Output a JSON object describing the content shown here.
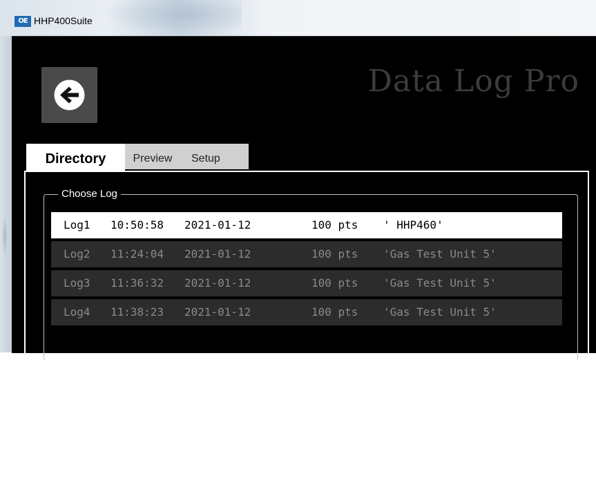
{
  "window": {
    "title": "HHP400Suite",
    "icon_text": "OE"
  },
  "header": {
    "brand_title": "Data Log Pro",
    "back_icon": "arrow-left-icon"
  },
  "tabs": [
    {
      "label": "Directory",
      "active": true
    },
    {
      "label": "Preview",
      "active": false
    },
    {
      "label": "Setup",
      "active": false
    }
  ],
  "directory": {
    "group_title": "Choose Log",
    "logs": [
      {
        "name": "Log1",
        "time": "10:50:58",
        "date": "2021-01-12",
        "points": "100 pts",
        "label": "' HHP460'",
        "selected": true
      },
      {
        "name": "Log2",
        "time": "11:24:04",
        "date": "2021-01-12",
        "points": "100 pts",
        "label": "'Gas Test Unit 5'",
        "selected": false
      },
      {
        "name": "Log3",
        "time": "11:36:32",
        "date": "2021-01-12",
        "points": "100 pts",
        "label": "'Gas Test Unit 5'",
        "selected": false
      },
      {
        "name": "Log4",
        "time": "11:38:23",
        "date": "2021-01-12",
        "points": "100 pts",
        "label": "'Gas Test Unit 5'",
        "selected": false
      }
    ]
  },
  "colors": {
    "background": "#000000",
    "selected_row": "#ffffff",
    "row": "#2c2c2c",
    "row_text": "#8a8a8a",
    "brand_text": "#3c3c3c"
  }
}
